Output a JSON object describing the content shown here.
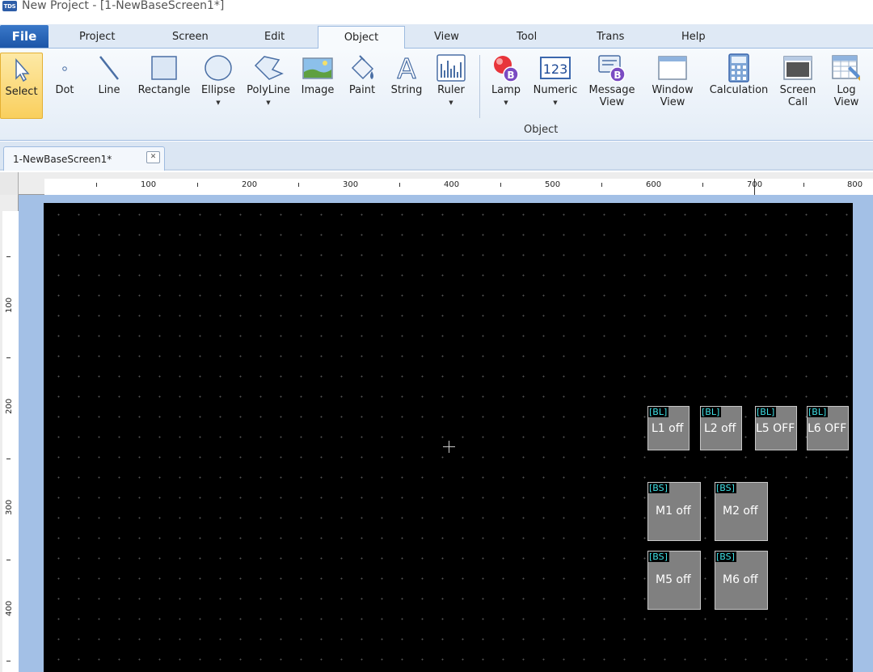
{
  "window": {
    "title": "New Project - [1-NewBaseScreen1*]",
    "logo_text": "TDS"
  },
  "menu": {
    "file": "File",
    "tabs": [
      "Project",
      "Screen",
      "Edit",
      "Object",
      "View",
      "Tool",
      "Trans",
      "Help"
    ],
    "active": "Object"
  },
  "ribbon": {
    "tools": [
      {
        "label": "Select",
        "icon": "cursor-arrow-icon",
        "selected": true
      },
      {
        "label": "Dot",
        "icon": "dot-icon"
      },
      {
        "label": "Line",
        "icon": "line-icon"
      },
      {
        "label": "Rectangle",
        "icon": "rectangle-icon"
      },
      {
        "label": "Ellipse",
        "icon": "ellipse-icon",
        "dropdown": true
      },
      {
        "label": "PolyLine",
        "icon": "polyline-icon",
        "dropdown": true
      },
      {
        "label": "Image",
        "icon": "image-icon"
      },
      {
        "label": "Paint",
        "icon": "paint-bucket-icon"
      },
      {
        "label": "String",
        "icon": "string-text-icon"
      },
      {
        "label": "Ruler",
        "icon": "ruler-bars-icon",
        "dropdown": true
      },
      {
        "label": "Lamp",
        "icon": "lamp-icon",
        "dropdown": true
      },
      {
        "label": "Numeric",
        "icon": "numeric-123-icon",
        "dropdown": true
      },
      {
        "label1": "Message",
        "label2": "View",
        "icon": "message-view-icon"
      },
      {
        "label1": "Window",
        "label2": "View",
        "icon": "window-view-icon"
      },
      {
        "label": "Calculation",
        "icon": "calculator-icon"
      },
      {
        "label1": "Screen",
        "label2": "Call",
        "icon": "screen-call-icon"
      },
      {
        "label1": "Log",
        "label2": "View",
        "icon": "log-view-icon"
      }
    ],
    "group_label": "Object",
    "numeric_icon_text": "123",
    "lamp_badge": "B",
    "dropdown_glyph": "▼"
  },
  "document": {
    "tab_title": "1-NewBaseScreen1*",
    "close_glyph": "✕"
  },
  "rulers": {
    "horizontal_labels": [
      "100",
      "200",
      "300",
      "400",
      "500",
      "600",
      "700",
      "800"
    ],
    "vertical_labels": [
      "100",
      "200",
      "300",
      "400"
    ]
  },
  "objects": {
    "lamps": [
      {
        "tag": "[BL]",
        "text": "L1 off"
      },
      {
        "tag": "[BL]",
        "text": "L2 off"
      },
      {
        "tag": "[BL]",
        "text": "L5 OFF"
      },
      {
        "tag": "[BL]",
        "text": "L6 OFF"
      }
    ],
    "switches": [
      {
        "tag": "[BS]",
        "text": "M1 off"
      },
      {
        "tag": "[BS]",
        "text": "M2 off"
      },
      {
        "tag": "[BS]",
        "text": "M5 off"
      },
      {
        "tag": "[BS]",
        "text": "M6 off"
      }
    ]
  },
  "colors": {
    "canvas": "#000000",
    "object_fill": "#808080",
    "tag_text": "#3fe0e6",
    "accent": "#1c56a8"
  }
}
